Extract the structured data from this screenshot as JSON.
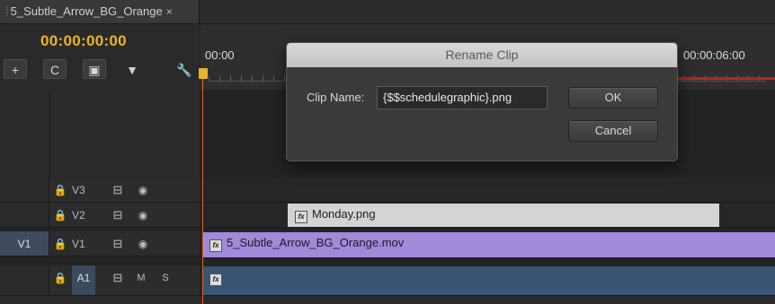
{
  "tab": {
    "title": "5_Subtle_Arrow_BG_Orange",
    "close": "×"
  },
  "timeline": {
    "timecode": "00:00:00:00",
    "ruler_start": "00:00",
    "ruler_end": "00:00:06:00"
  },
  "tools": {
    "snap": "+",
    "link": "C",
    "markers": "▣",
    "add_marker": "▼",
    "settings": "🔧"
  },
  "tracks": [
    {
      "name": "V3",
      "source": "",
      "toggle": "⊟",
      "eye": "◉"
    },
    {
      "name": "V2",
      "source": "",
      "toggle": "⊟",
      "eye": "◉"
    },
    {
      "name": "V1",
      "source": "V1",
      "toggle": "⊟",
      "eye": "◉"
    },
    {
      "name": "A1",
      "source": "",
      "toggle": "⊟",
      "mute": "M",
      "solo": "S"
    }
  ],
  "lock_glyph": "🔒",
  "clips": {
    "v2": {
      "fx": "fx",
      "label": "Monday.png"
    },
    "v1": {
      "fx": "fx",
      "label": "5_Subtle_Arrow_BG_Orange.mov"
    },
    "a1": {
      "fx": "fx",
      "label": ""
    }
  },
  "dialog": {
    "title": "Rename Clip",
    "label": "Clip Name:",
    "value": "{$$schedulegraphic}.png",
    "ok": "OK",
    "cancel": "Cancel"
  }
}
